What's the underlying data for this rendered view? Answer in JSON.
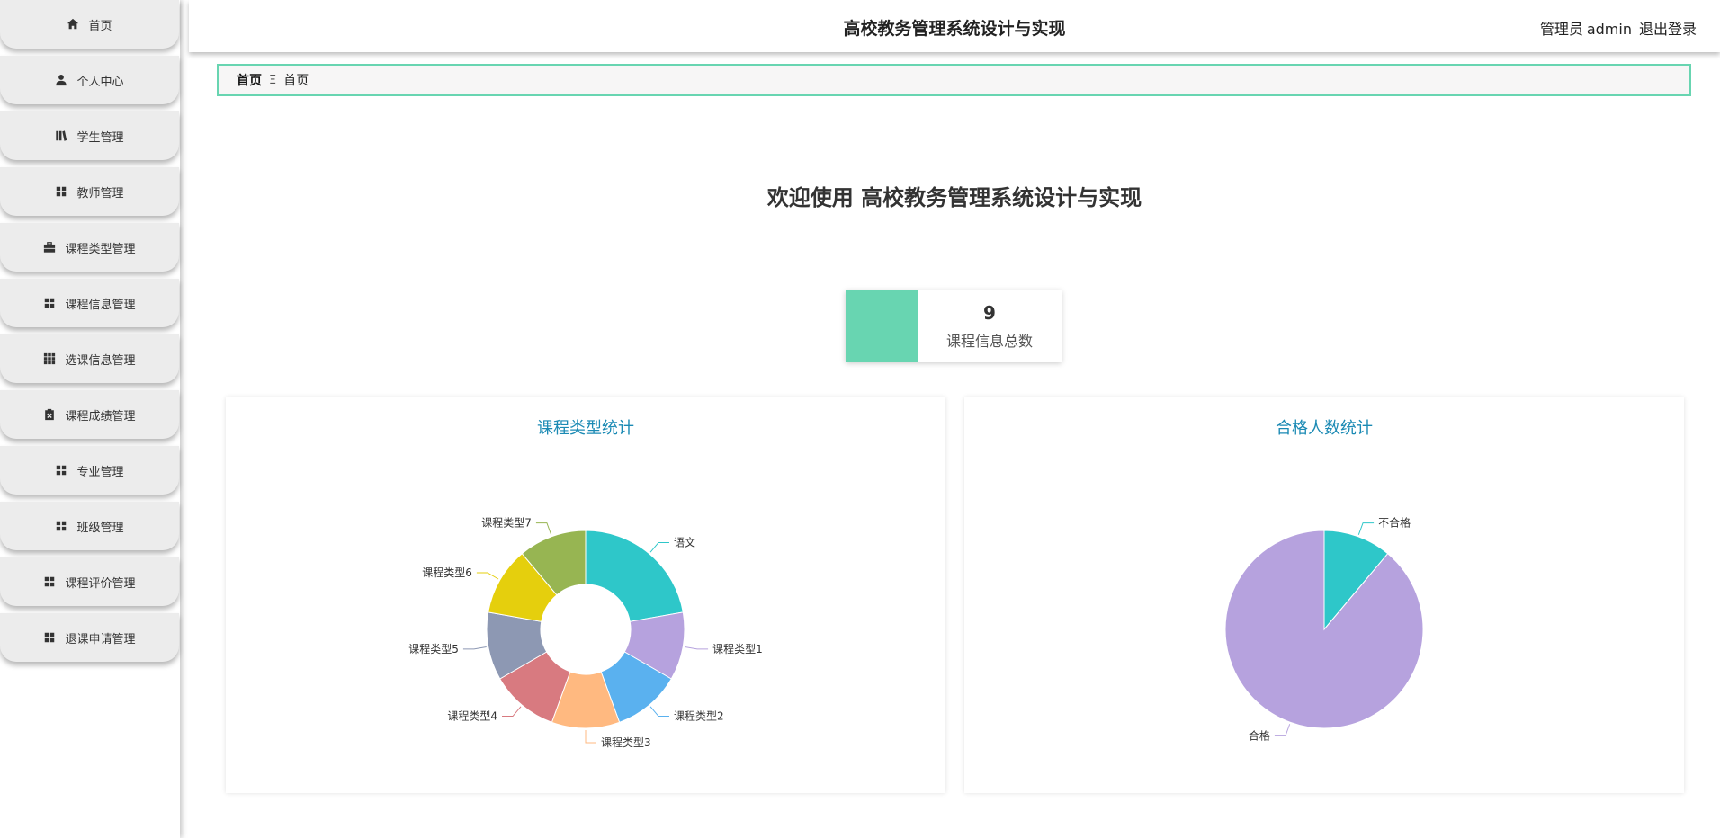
{
  "sidebar": {
    "items": [
      {
        "label": "首页",
        "icon": "home-icon"
      },
      {
        "label": "个人中心",
        "icon": "user-icon"
      },
      {
        "label": "学生管理",
        "icon": "book-icon"
      },
      {
        "label": "教师管理",
        "icon": "grid-icon"
      },
      {
        "label": "课程类型管理",
        "icon": "briefcase-icon"
      },
      {
        "label": "课程信息管理",
        "icon": "grid-icon"
      },
      {
        "label": "选课信息管理",
        "icon": "apps-icon"
      },
      {
        "label": "课程成绩管理",
        "icon": "clipboard-icon"
      },
      {
        "label": "专业管理",
        "icon": "grid-icon"
      },
      {
        "label": "班级管理",
        "icon": "grid-icon"
      },
      {
        "label": "课程评价管理",
        "icon": "grid-icon"
      },
      {
        "label": "退课申请管理",
        "icon": "grid-icon"
      }
    ]
  },
  "header": {
    "title": "高校教务管理系统设计与实现",
    "user_role": "管理员",
    "username": "admin",
    "logout_label": "退出登录"
  },
  "breadcrumb": {
    "home": "首页",
    "separator": "Ξ",
    "current": "首页"
  },
  "welcome_text": "欢迎使用 高校教务管理系统设计与实现",
  "stat_card": {
    "value": "9",
    "label": "课程信息总数",
    "color": "#68d5b1"
  },
  "colors": {
    "accent": "#68d5b1",
    "panel_title": "#1b8ab4"
  },
  "chart_data": [
    {
      "type": "pie",
      "variant": "donut",
      "title": "课程类型统计",
      "labels": [
        "语文",
        "课程类型1",
        "课程类型2",
        "课程类型3",
        "课程类型4",
        "课程类型5",
        "课程类型6",
        "课程类型7"
      ],
      "values": [
        2,
        1,
        1,
        1,
        1,
        1,
        1,
        1
      ],
      "colors": [
        "#2ec7c9",
        "#b6a2de",
        "#5ab1ef",
        "#ffb980",
        "#d87a80",
        "#8d98b3",
        "#e5cf0d",
        "#97b552"
      ]
    },
    {
      "type": "pie",
      "title": "合格人数统计",
      "labels": [
        "不合格",
        "合格"
      ],
      "values": [
        1,
        8
      ],
      "colors": [
        "#2ec7c9",
        "#b6a2de"
      ]
    }
  ]
}
